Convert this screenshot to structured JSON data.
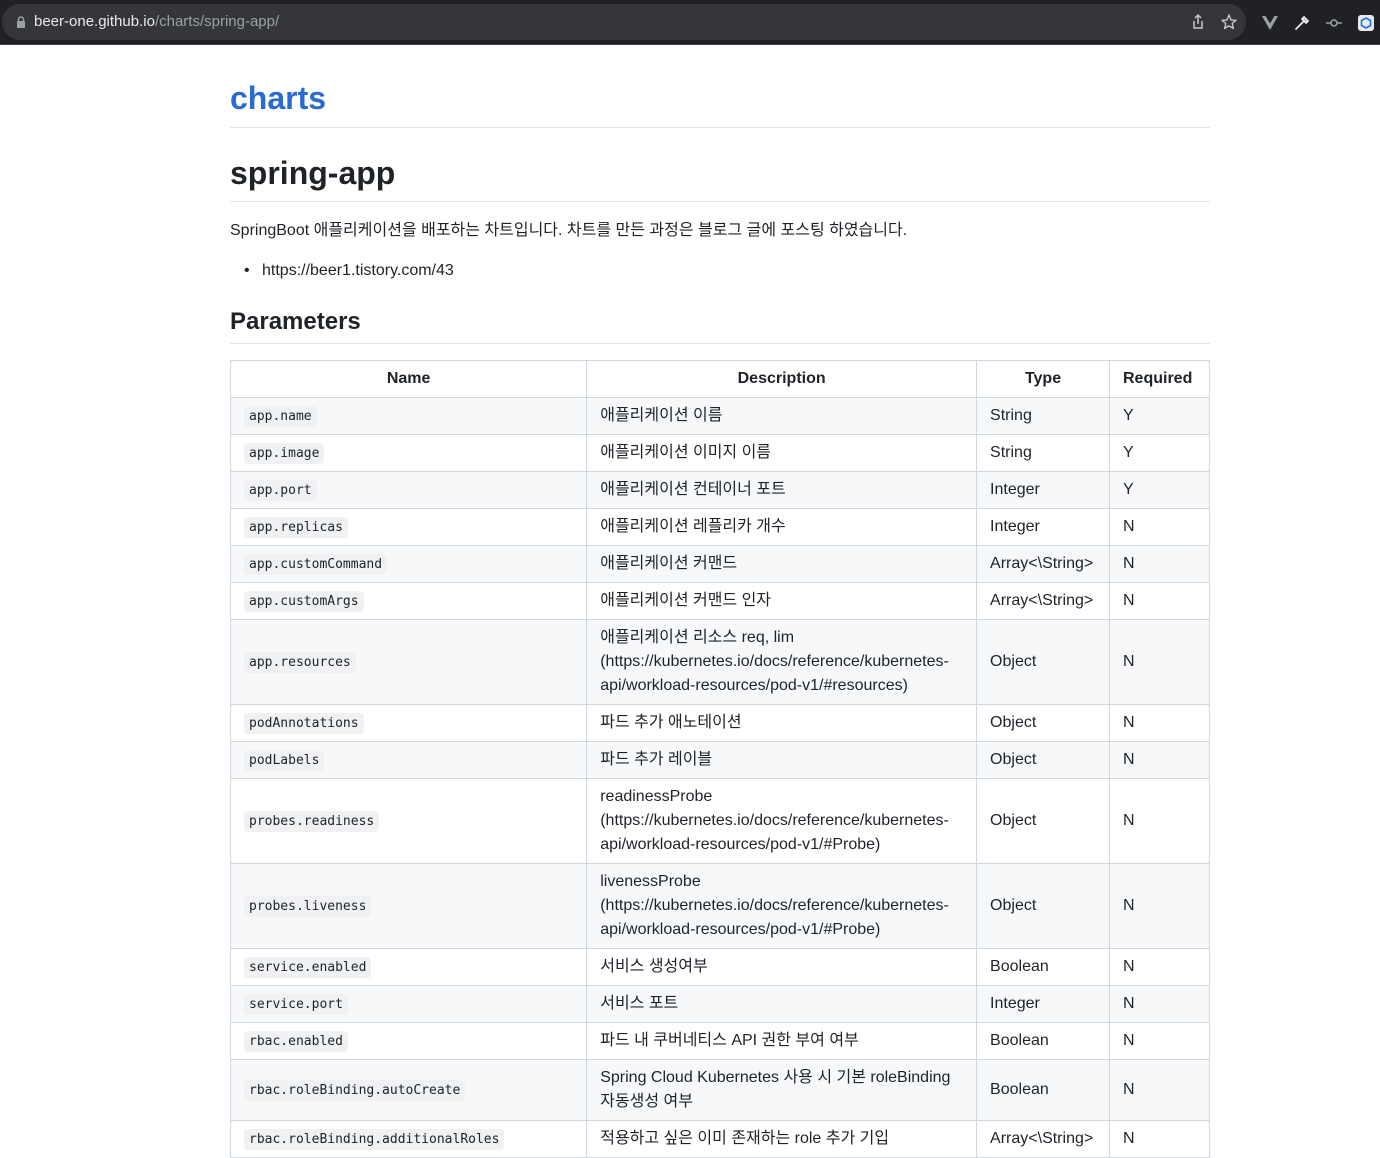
{
  "browser": {
    "url_host": "beer-one.github.io",
    "url_path": "/charts/spring-app/"
  },
  "site": {
    "title": "charts"
  },
  "page": {
    "title": "spring-app",
    "intro": "SpringBoot 애플리케이션을 배포하는 차트입니다. 차트를 만든 과정은 블로그 글에 포스팅 하였습니다.",
    "links": [
      "https://beer1.tistory.com/43"
    ],
    "section_title": "Parameters"
  },
  "table": {
    "headers": [
      "Name",
      "Description",
      "Type",
      "Required"
    ],
    "rows": [
      {
        "name": "app.name",
        "desc": "애플리케이션 이름",
        "type": "String",
        "req": "Y"
      },
      {
        "name": "app.image",
        "desc": "애플리케이션 이미지 이름",
        "type": "String",
        "req": "Y"
      },
      {
        "name": "app.port",
        "desc": "애플리케이션 컨테이너 포트",
        "type": "Integer",
        "req": "Y"
      },
      {
        "name": "app.replicas",
        "desc": "애플리케이션 레플리카 개수",
        "type": "Integer",
        "req": "N"
      },
      {
        "name": "app.customCommand",
        "desc": "애플리케이션 커맨드",
        "type": "Array<\\String>",
        "req": "N"
      },
      {
        "name": "app.customArgs",
        "desc": "애플리케이션 커맨드 인자",
        "type": "Array<\\String>",
        "req": "N"
      },
      {
        "name": "app.resources",
        "desc": "애플리케이션 리소스 req, lim\n(https://kubernetes.io/docs/reference/kubernetes-\napi/workload-resources/pod-v1/#resources)",
        "type": "Object",
        "req": "N"
      },
      {
        "name": "podAnnotations",
        "desc": "파드 추가 애노테이션",
        "type": "Object",
        "req": "N"
      },
      {
        "name": "podLabels",
        "desc": "파드 추가 레이블",
        "type": "Object",
        "req": "N"
      },
      {
        "name": "probes.readiness",
        "desc": "readinessProbe\n(https://kubernetes.io/docs/reference/kubernetes-\napi/workload-resources/pod-v1/#Probe)",
        "type": "Object",
        "req": "N"
      },
      {
        "name": "probes.liveness",
        "desc": "livenessProbe\n(https://kubernetes.io/docs/reference/kubernetes-\napi/workload-resources/pod-v1/#Probe)",
        "type": "Object",
        "req": "N"
      },
      {
        "name": "service.enabled",
        "desc": "서비스 생성여부",
        "type": "Boolean",
        "req": "N"
      },
      {
        "name": "service.port",
        "desc": "서비스 포트",
        "type": "Integer",
        "req": "N"
      },
      {
        "name": "rbac.enabled",
        "desc": "파드 내 쿠버네티스 API 권한 부여 여부",
        "type": "Boolean",
        "req": "N"
      },
      {
        "name": "rbac.roleBinding.autoCreate",
        "desc": "Spring Cloud Kubernetes 사용 시 기본 roleBinding\n자동생성 여부",
        "type": "Boolean",
        "req": "N"
      },
      {
        "name": "rbac.roleBinding.additionalRoles",
        "desc": "적용하고 싶은 이미 존재하는 role 추가 기입",
        "type": "Array<\\String>",
        "req": "N"
      }
    ]
  },
  "icons": {
    "lock": "lock-icon",
    "share": "share-icon",
    "star": "star-icon",
    "ext1": "vue-devtools-icon",
    "ext2": "eyedropper-icon",
    "ext3": "commit-icon",
    "ext4": "extension-icon"
  }
}
